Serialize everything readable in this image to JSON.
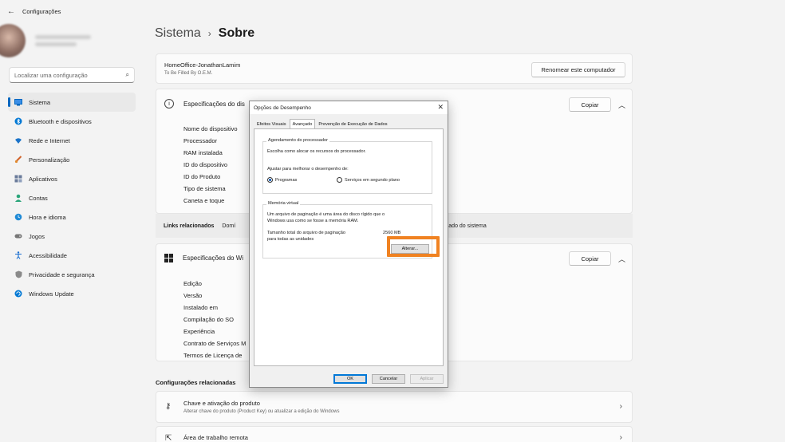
{
  "window": {
    "title": "Configurações",
    "back_icon": "back-arrow-icon"
  },
  "sidebar": {
    "search_placeholder": "Localizar uma configuração",
    "items": [
      {
        "label": "Sistema",
        "icon": "monitor-icon",
        "color": "#0067c0",
        "active": true
      },
      {
        "label": "Bluetooth e dispositivos",
        "icon": "bluetooth-icon",
        "color": "#0078d4"
      },
      {
        "label": "Rede e Internet",
        "icon": "wifi-icon",
        "color": "#1a73c9"
      },
      {
        "label": "Personalização",
        "icon": "brush-icon",
        "color": "#d1632a"
      },
      {
        "label": "Aplicativos",
        "icon": "apps-icon",
        "color": "#5a6b8a"
      },
      {
        "label": "Contas",
        "icon": "person-icon",
        "color": "#2aa57a"
      },
      {
        "label": "Hora e idioma",
        "icon": "globe-clock-icon",
        "color": "#1f8ad6"
      },
      {
        "label": "Jogos",
        "icon": "gamepad-icon",
        "color": "#6b6b6b"
      },
      {
        "label": "Acessibilidade",
        "icon": "accessibility-icon",
        "color": "#1a6fd1"
      },
      {
        "label": "Privacidade e segurança",
        "icon": "shield-icon",
        "color": "#6b6b6b"
      },
      {
        "label": "Windows Update",
        "icon": "update-icon",
        "color": "#0078d4"
      }
    ]
  },
  "breadcrumb": {
    "parent": "Sistema",
    "separator": "›",
    "current": "Sobre"
  },
  "pc_card": {
    "name": "HomeOffice-JonathanLamim",
    "sub": "To Be Filled By O.E.M.",
    "rename_label": "Renomear este computador"
  },
  "device_specs": {
    "title": "Especificações do dispositivo",
    "visible_title": "Especificações do dis",
    "copy_label": "Copiar",
    "rows": [
      "Nome do dispositivo",
      "Processador",
      "RAM instalada",
      "ID do dispositivo",
      "ID do Produto",
      "Tipo de sistema",
      "Caneta e toque"
    ]
  },
  "links": {
    "label": "Links relacionados",
    "domain": "Domí",
    "right": "ançado do sistema"
  },
  "windows_specs": {
    "visible_title": "Especificações do Wi",
    "copy_label": "Copiar",
    "rows": [
      "Edição",
      "Versão",
      "Instalado em",
      "Compilação do SO",
      "Experiência",
      "Contrato de Serviços M",
      "Termos de Licença de"
    ]
  },
  "related": {
    "title": "Configurações relacionadas",
    "items": [
      {
        "title": "Chave e ativação do produto",
        "sub": "Alterar chave do produto (Product Key) ou atualizar a edição do Windows",
        "icon": "key-icon"
      },
      {
        "title": "Área de trabalho remota",
        "sub": "",
        "icon": "remote-desktop-icon"
      }
    ]
  },
  "dialog": {
    "title": "Opções de Desempenho",
    "tabs": [
      "Efeitos Visuais",
      "Avançado",
      "Prevenção de Execução de Dados"
    ],
    "active_tab": "Avançado",
    "scheduling": {
      "legend": "Agendamento do processador",
      "desc": "Escolha como alocar os recursos do processador.",
      "adjust": "Ajustar para melhorar o desempenho de:",
      "opt1": "Programas",
      "opt2": "Serviços em segundo plano",
      "selected": "Programas"
    },
    "virtual_memory": {
      "legend": "Memória virtual",
      "desc_line1": "Um arquivo de paginação é uma área do disco rígido que o",
      "desc_line2": "Windows usa como se fosse a memória RAM.",
      "total_line1": "Tamanho total do arquivo de paginação",
      "total_line2": "para todas as unidades",
      "total_value": "2560 MB",
      "change_label": "Alterar..."
    },
    "ok_label": "OK",
    "cancel_label": "Cancelar",
    "apply_label": "Aplicar",
    "highlight_color": "#f08221"
  }
}
